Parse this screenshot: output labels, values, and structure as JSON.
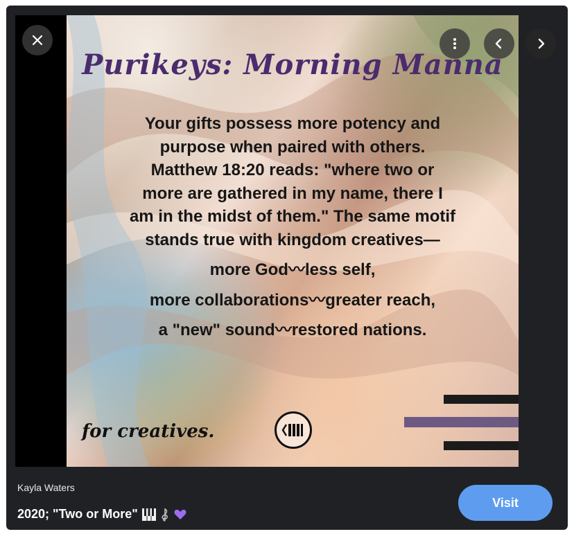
{
  "viewer": {
    "controls": {
      "close_icon": "close-icon",
      "more_icon": "more-vertical-icon",
      "prev_icon": "chevron-left-icon",
      "next_icon": "chevron-right-icon"
    },
    "image": {
      "title": "Purikeys: Morning Manna",
      "quote_lines": [
        "Your gifts possess more potency and",
        "purpose when paired with others.",
        "Matthew 18:20 reads: \"where two or",
        "more are gathered in my name, there I",
        "am in the midst of them.\" The same motif",
        "stands true with kingdom creatives—",
        "more God〰less self,",
        "more collaborations〰greater reach,",
        "a \"new\" sound〰restored nations."
      ],
      "signature": "for creatives.",
      "colors": {
        "title": "#4a2c6e",
        "stripe_dark": "#1b1b1b",
        "stripe_purple": "#6c5a83"
      }
    }
  },
  "footer": {
    "author": "Kayla Waters",
    "caption": "2020; \"Two or More\"",
    "caption_icons": [
      "piano-keys-icon",
      "treble-clef-icon",
      "purple-heart-icon"
    ],
    "visit_label": "Visit",
    "accent": "#5e9cf0"
  }
}
